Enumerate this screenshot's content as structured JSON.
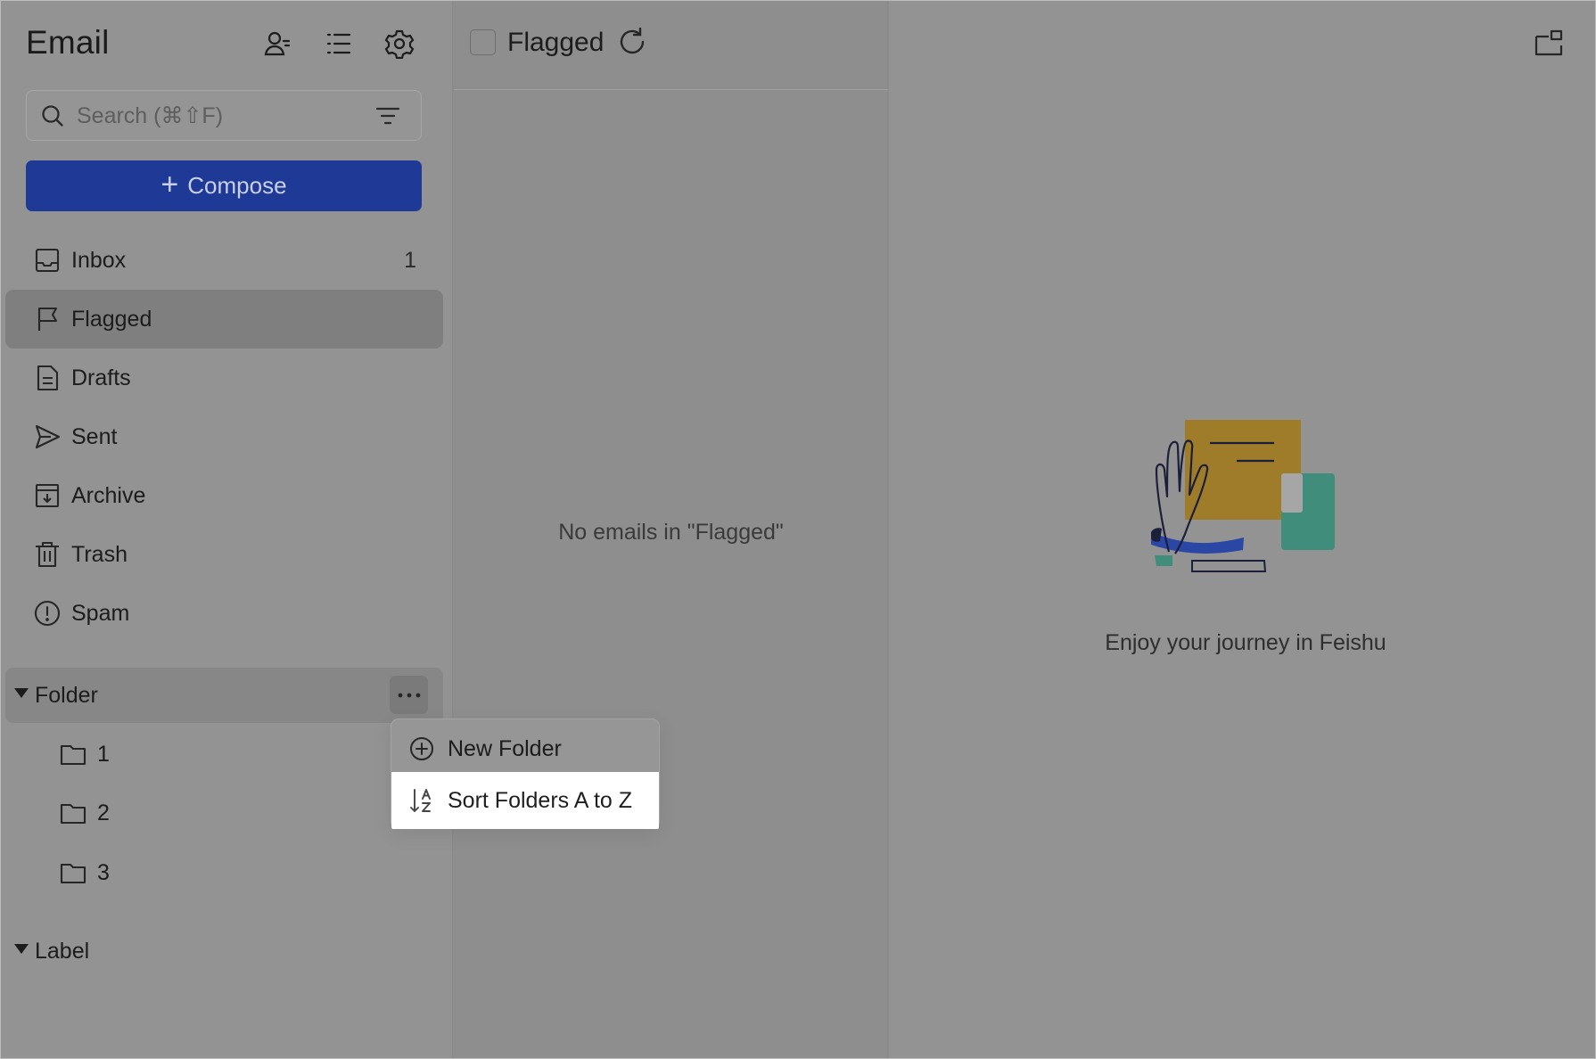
{
  "app": {
    "title": "Email"
  },
  "search": {
    "placeholder": "Search (⌘⇧F)"
  },
  "compose": {
    "label": "Compose"
  },
  "nav": {
    "items": [
      {
        "label": "Inbox",
        "count": "1",
        "icon": "inbox-icon"
      },
      {
        "label": "Flagged",
        "count": "",
        "icon": "flag-icon",
        "active": true
      },
      {
        "label": "Drafts",
        "count": "",
        "icon": "draft-icon"
      },
      {
        "label": "Sent",
        "count": "",
        "icon": "send-icon"
      },
      {
        "label": "Archive",
        "count": "",
        "icon": "archive-icon"
      },
      {
        "label": "Trash",
        "count": "",
        "icon": "trash-icon"
      },
      {
        "label": "Spam",
        "count": "",
        "icon": "spam-icon"
      }
    ]
  },
  "folders": {
    "label": "Folder",
    "items": [
      "1",
      "2",
      "3"
    ]
  },
  "labels": {
    "label": "Label"
  },
  "context_menu": {
    "items": [
      {
        "label": "New Folder",
        "icon": "plus-circle-icon"
      },
      {
        "label": "Sort Folders A to Z",
        "icon": "sort-az-icon"
      }
    ]
  },
  "list": {
    "title": "Flagged",
    "empty_message": "No emails in \"Flagged\""
  },
  "viewer": {
    "empty_message": "Enjoy your journey in Feishu"
  },
  "colors": {
    "compose_bg": "#1f3a96",
    "illustration_yellow": "#9e7c2a",
    "illustration_green": "#3f8d7a",
    "illustration_blue": "#2b47a6"
  }
}
